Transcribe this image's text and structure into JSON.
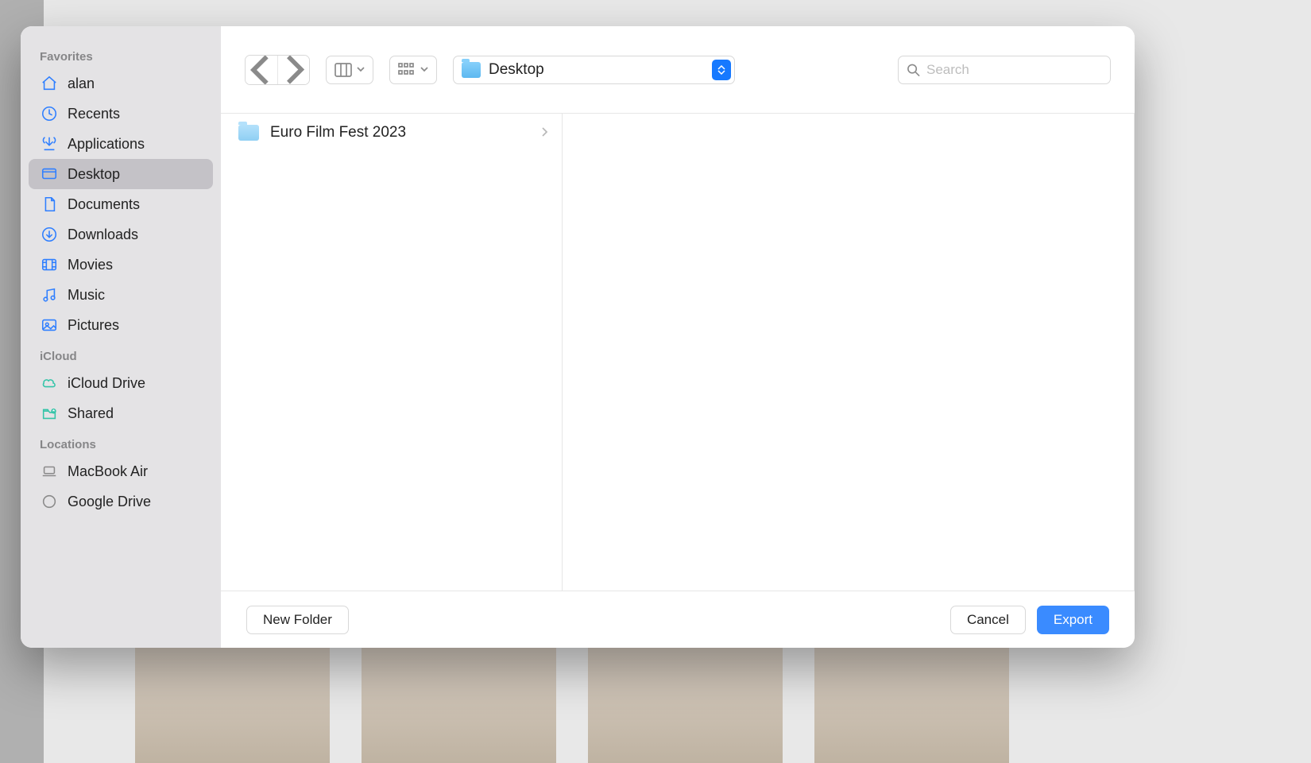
{
  "sidebar": {
    "sections": [
      {
        "title": "Favorites",
        "items": [
          {
            "name": "alan",
            "icon": "home",
            "selected": false
          },
          {
            "name": "Recents",
            "icon": "clock",
            "selected": false
          },
          {
            "name": "Applications",
            "icon": "apps",
            "selected": false
          },
          {
            "name": "Desktop",
            "icon": "desktop",
            "selected": true
          },
          {
            "name": "Documents",
            "icon": "doc",
            "selected": false
          },
          {
            "name": "Downloads",
            "icon": "download",
            "selected": false
          },
          {
            "name": "Movies",
            "icon": "movie",
            "selected": false
          },
          {
            "name": "Music",
            "icon": "music",
            "selected": false
          },
          {
            "name": "Pictures",
            "icon": "picture",
            "selected": false
          }
        ]
      },
      {
        "title": "iCloud",
        "items": [
          {
            "name": "iCloud Drive",
            "icon": "cloud",
            "selected": false
          },
          {
            "name": "Shared",
            "icon": "shared",
            "selected": false
          }
        ]
      },
      {
        "title": "Locations",
        "items": [
          {
            "name": "MacBook Air",
            "icon": "laptop",
            "selected": false
          },
          {
            "name": "Google Drive",
            "icon": "disk",
            "selected": false
          }
        ]
      }
    ]
  },
  "toolbar": {
    "location": "Desktop",
    "search_placeholder": "Search"
  },
  "browser": {
    "columns": [
      {
        "items": [
          {
            "name": "Euro Film Fest 2023",
            "type": "folder"
          }
        ]
      },
      {
        "items": []
      }
    ]
  },
  "footer": {
    "new_folder": "New Folder",
    "cancel": "Cancel",
    "confirm": "Export"
  }
}
